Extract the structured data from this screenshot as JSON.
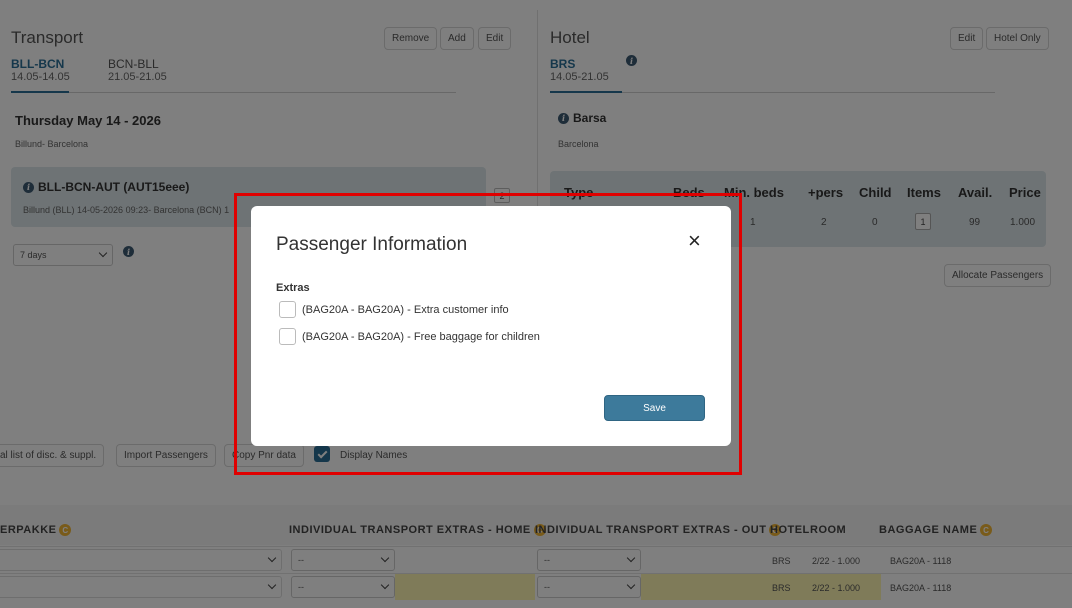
{
  "transport": {
    "title": "Transport",
    "buttons": [
      "Remove",
      "Add",
      "Edit"
    ],
    "tabs": [
      {
        "label": "BLL-BCN",
        "date": "14.05-14.05"
      },
      {
        "label": "BCN-BLL",
        "date": "21.05-21.05"
      }
    ],
    "day_heading": "Thursday May 14 - 2026",
    "route": "Billund- Barcelona",
    "card_title": "BLL-BCN-AUT (AUT15eee)",
    "card_detail": "Billund (BLL) 14-05-2026 09:23- Barcelona (BCN) 1",
    "card_count": "2",
    "duration_select": "7 days"
  },
  "hotel": {
    "title": "Hotel",
    "buttons": [
      "Edit",
      "Hotel Only"
    ],
    "tab": {
      "label": "BRS",
      "date": "14.05-21.05"
    },
    "name": "Barsa",
    "city": "Barcelona",
    "table_headers": [
      "Type",
      "Beds",
      "Min. beds",
      "+pers",
      "Child",
      "Items",
      "Avail.",
      "Price"
    ],
    "table_row": {
      "min_beds": "1",
      "pers": "2",
      "child": "0",
      "items": "1",
      "avail": "99",
      "price": "1.000"
    },
    "allocate_button": "Allocate Passengers"
  },
  "toolbar": {
    "list_button": "al list of disc. & suppl.",
    "import_button": "Import Passengers",
    "copy_button": "Copy Pnr data",
    "display_names_label": "Display Names"
  },
  "grid": {
    "headers": [
      "ERPAKKE",
      "INDIVIDUAL TRANSPORT EXTRAS - HOME",
      "INDIVIDUAL TRANSPORT EXTRAS - OUT",
      "HOTEL",
      "ROOM",
      "BAGGAGE NAME"
    ],
    "coin_symbol": "C",
    "rows": [
      {
        "home": "--",
        "out": "--",
        "hotel": "BRS",
        "room": "2/22 - 1.000",
        "baggage": "BAG20A - 1118"
      },
      {
        "home": "--",
        "out": "--",
        "hotel": "BRS",
        "room": "2/22 - 1.000",
        "baggage": "BAG20A - 1118"
      }
    ]
  },
  "modal": {
    "title": "Passenger Information",
    "close_symbol": "×",
    "extras_label": "Extras",
    "extras": [
      "(BAG20A - BAG20A) - Extra customer info",
      "(BAG20A - BAG20A) - Free baggage for children"
    ],
    "save_label": "Save"
  },
  "colors": {
    "accent": "#2a6f97",
    "save_button": "#3d7a9b",
    "highlight_border": "#e00000",
    "row_highlight": "#fff7b3"
  }
}
